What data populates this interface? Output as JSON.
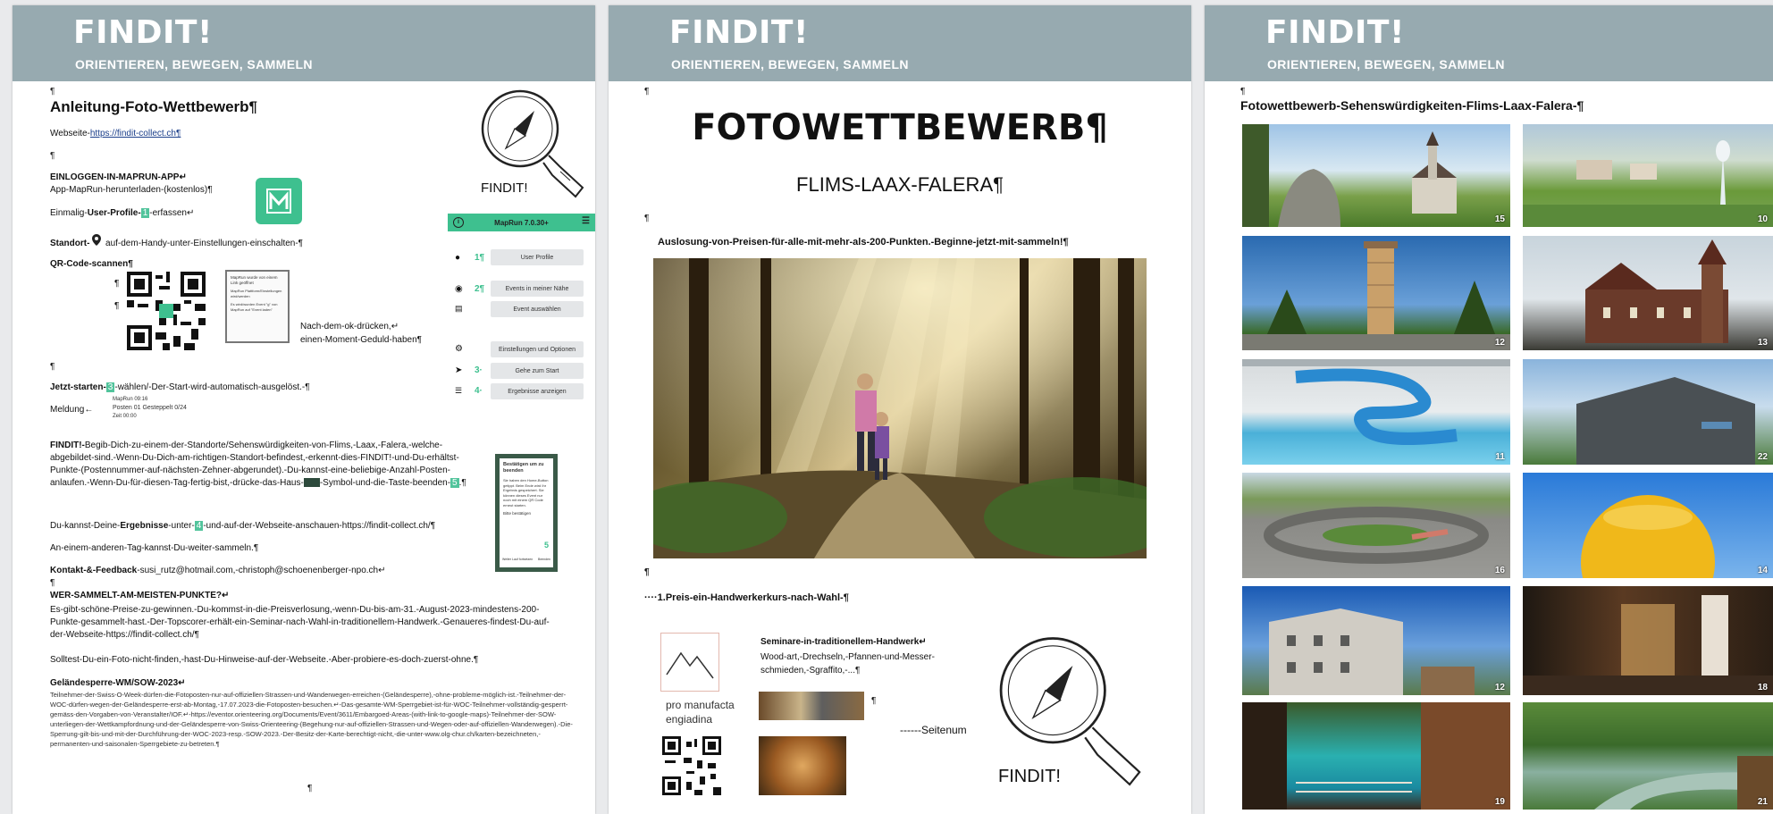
{
  "header": {
    "brand": "FINDIT!",
    "tagline": "ORIENTIEREN, BEWEGEN, SAMMELN"
  },
  "pilcrow": "¶",
  "page1": {
    "title": "Anleitung-Foto-Wettbewerb¶",
    "website_prefix": "Webseite-",
    "website_link": "https://findit-collect.ch¶",
    "login_title": "EINLOGGEN-IN-MAPRUN-APP↵",
    "app_line": "App-MapRun-herunterladen-(kostenlos)¶",
    "once_pre": "Einmalig-",
    "once_bold": "User-Profile-",
    "once_num": "1",
    "once_post": "-erfassen↵",
    "standort_bold": "Standort-",
    "standort_rest": "auf-dem-Handy-unter-Einstellungen-einschalten-¶",
    "qr_title": "QR-Code-scannen¶",
    "scan_note_1": "Nach-dem-ok-drücken,↵",
    "scan_note_2": "einen-Moment-Geduld-haben¶",
    "start_bold": "Jetzt-starten-",
    "start_num": "3",
    "start_rest": "-wählen/-Der-Start-wird-automatisch-ausgelöst.-¶",
    "meldung": "Meldung←",
    "melding_lines": [
      "MapRun 09:16",
      "Posten 01 Gesteppelt 0/24",
      "Zeit 00:00"
    ],
    "para1": "Begib-Dich-zu-einem-der-Standorte/Sehenswürdigkeiten-von-Flims,-Laax,-Falera,-welche-abgebildet-sind.-Wenn-Du-Dich-am-richtigen-Standort-befindest,-erkennt-dies-FINDIT!-und-Du-erhältst-Punkte-(Postennummer-auf-nächsten-Zehner-abgerundet).-Du-kannst-eine-beliebige-Anzahl-Posten-anlaufen.-Wenn-Du-für-diesen-Tag-fertig-bist,-drücke-das-Haus-",
    "para1_lead": "FINDIT!-",
    "para1_tail_a": "-Symbol-und-die-Taste-",
    "para1_tail_b": "beenden-",
    "para1_num": "5",
    "para1_end": ".¶",
    "results_pre": "Du-kannst-Deine-",
    "results_bold": "Ergebnisse",
    "results_mid": "-unter-",
    "results_num": "4",
    "results_post": "-und-auf-der-Webseite-anschauen-https://findit-collect.ch/¶",
    "another_day": "An-einem-anderen-Tag-kannst-Du-weiter-sammeln.¶",
    "contact_bold": "Kontakt-&-Feedback",
    "contact_rest": "-susi_rutz@hotmail.com,-christoph@schoenenberger-npo.ch↵",
    "winner_title": "WER-SAMMELT-AM-MEISTEN-PUNKTE?↵",
    "winner_text": "Es-gibt-schöne-Preise-zu-gewinnen.-Du-kommst-in-die-Preisverlosung,-wenn-Du-bis-am-31.-August-2023-mindestens-200-Punkte-gesammelt-hast.-Der-Topscorer-erhält-ein-Seminar-nach-Wahl-in-traditionellem-Handwerk.-Genaueres-findest-Du-auf-der-Webseite-https://findit-collect.ch/¶",
    "photo_missing": "Solltest-Du-ein-Foto-nicht-finden,-hast-Du-Hinweise-auf-der-Webseite.-Aber-probiere-es-doch-zuerst-ohne.¶",
    "closure_title": "Geländesperre-WM/SOW-2023↵",
    "closure_text": "Teilnehmer-der-Swiss-O-Week-dürfen-die-Fotoposten-nur-auf-offiziellen-Strassen-und-Wanderwegen-erreichen-(Geländesperre),-ohne-probleme-möglich-ist.-Teilnehmer-der-WOC-dürfen-wegen-der-Geländesperre-erst-ab-Montag,-17.07.2023-die-Fotoposten-besuchen.↵-Das-gesamte-WM-Sperrgebiet-ist-für-WOC-Teilnehmer-vollständig-gesperrt-gemäss-den-Vorgaben-von-Veranstalter/IOF.↵-https://eventor.orienteering.org/Documents/Event/3611/Embargoed-Areas-(with-link-to-google-maps)-Teilnehmer-der-SOW-unterliegen-der-Wettkampfordnung-und-der-Geländesperre-von-Swiss-Orienteering-(Begehung-nur-auf-offiziellen-Strassen-und-Wegen-oder-auf-offiziellen-Wanderwegen).-Die-Sperrung-gilt-bis-und-mit-der-Durchführung-der-WOC-2023-resp.-SOW-2023.-Der-Besitz-der-Karte-berechtigt-nicht,-die-unter-www.olg-chur.ch/karten-bezeichneten,-permanenten-und-saisonalen-Sperrgebiete-zu-betreten.¶",
    "compass_label": "FINDIT!",
    "popup_lines": [
      "MapRun wurde von einem Link geöffnet",
      "MapRun Plattform/Einstellungen wird/werden",
      "Es wird/wurden Event \"g\" von MapRun auf \"Event laden\""
    ],
    "finish_popup": {
      "title": "Bestätigen um zu beenden",
      "body": "Sie haben den Home-Button getippt. Beim Ende wird Ihr Ergebnis gespeichert. Sie können dieses Event nur noch mit einem QR Code erneut starten.",
      "more": "Bitte bestätigen",
      "num": "5",
      "left": "Weiter Lauf fortsetzen",
      "right": "Beenden"
    },
    "app": {
      "title": "MapRun 7.0.30+",
      "items": [
        {
          "num": "1¶",
          "label": "User Profile"
        },
        {
          "num": "2¶",
          "label": "Events in meiner Nähe"
        },
        {
          "num": "",
          "label": "Event auswählen"
        },
        {
          "num": "",
          "label": "Einstellungen und Optionen"
        },
        {
          "num": "3·",
          "label": "Gehe zum Start"
        },
        {
          "num": "4·",
          "label": "Ergebnisse anzeigen"
        }
      ]
    }
  },
  "page2": {
    "title": "FOTOWETTBEWERB¶",
    "subtitle": "FLIMS-LAAX-FALERA¶",
    "draw": "Auslosung-von-Preisen-für-alle-mit-mehr-als-200-Punkten.-Beginne-jetzt-mit-sammeln!¶",
    "prize": "····1.Preis-ein-Handwerkerkurs-nach-Wahl-¶",
    "seminar_title": "Seminare-in-traditionellem-Handwerk↵",
    "seminar_text_1": "Wood-art,-Drechseln,-Pfannen-und-Messer-",
    "seminar_text_2": "schmieden,-Sgraffito,-...¶",
    "logo_1": "pro manufacta",
    "logo_2": "engiadina",
    "seitenum": "------Seitenum",
    "compass_label": "FINDIT!"
  },
  "page3": {
    "title": "Fotowettbewerb-Sehenswürdigkeiten-Flims-Laax-Falera-¶",
    "tiles": [
      "15",
      "10",
      "12",
      "13",
      "11",
      "22",
      "16",
      "14",
      "12",
      "18",
      "19",
      "21"
    ]
  }
}
